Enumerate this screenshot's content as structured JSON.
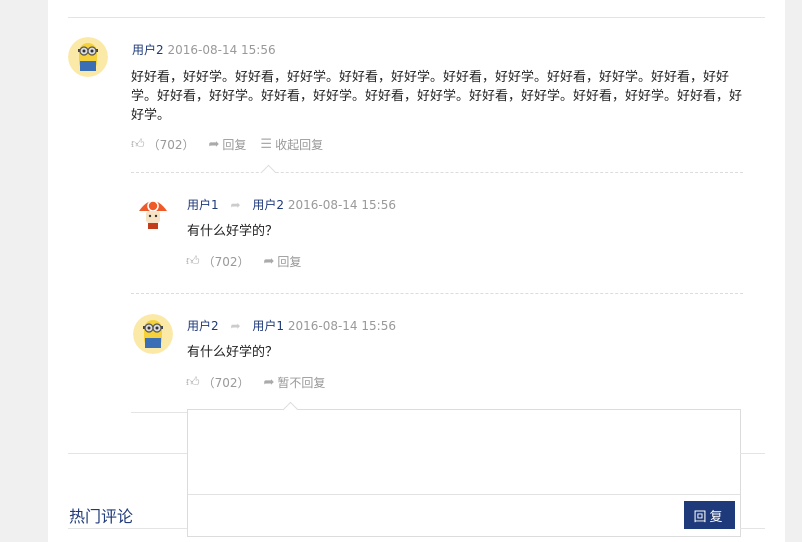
{
  "comment": {
    "user": "用户2",
    "time": "2016-08-14 15:56",
    "text": "好好看，好好学。好好看，好好学。好好看，好好学。好好看，好好学。好好看，好好学。好好看，好好学。好好看，好好学。好好看，好好学。好好看，好好学。好好看，好好学。好好看，好好学。好好看，好好学。",
    "likes": "（702）",
    "reply_label": "回复",
    "collapse_label": "收起回复"
  },
  "replies": [
    {
      "user": "用户1",
      "to_user": "用户2",
      "time": "2016-08-14 15:56",
      "text": "有什么好学的？",
      "likes": "（702）",
      "reply_label": "回复"
    },
    {
      "user": "用户2",
      "to_user": "用户1",
      "time": "2016-08-14 15:56",
      "text": "有什么好学的？",
      "likes": "（702）",
      "reply_label": "暂不回复"
    }
  ],
  "reply_box": {
    "button_label": "回复"
  },
  "hot_comments_title": "热门评论",
  "icons": {
    "like": "thumbs-up-icon",
    "reply": "share-arrow-icon",
    "collapse": "list-icon",
    "reply_to": "forward-arrow-icon"
  },
  "colors": {
    "accent": "#1f3a7a",
    "muted": "#999999"
  }
}
